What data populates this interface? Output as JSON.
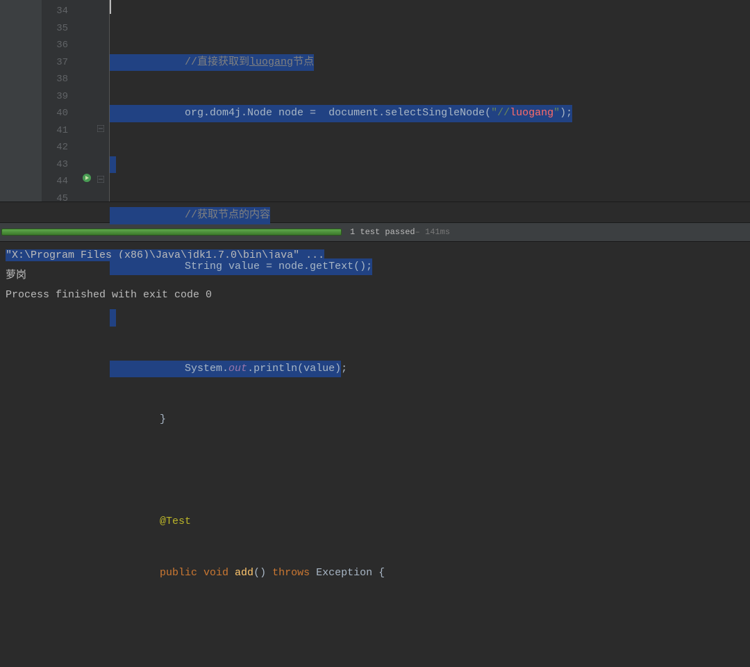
{
  "gutter": {
    "lines": [
      "34",
      "35",
      "36",
      "37",
      "38",
      "39",
      "40",
      "41",
      "42",
      "43",
      "44",
      "45"
    ]
  },
  "code": {
    "l34_pad": "            ",
    "l34_comment_a": "//直接获取到",
    "l34_comment_b": "luogang",
    "l34_comment_c": "节点",
    "l35_pad": "            ",
    "l35_a": "org.dom4j.Node node =  document.selectSingleNode(",
    "l35_str_open": "\"//",
    "l35_str_err": "luogang",
    "l35_str_close": "\"",
    "l35_b": ");",
    "l37_pad": "            ",
    "l37_comment": "//获取节点的内容",
    "l38_pad": "            ",
    "l38_a": "String value = node.getText();",
    "l40_pad": "            ",
    "l40_a": "System.",
    "l40_out": "out",
    "l40_b": ".println(value)",
    "l40_c": ";",
    "l41_pad": "        ",
    "l41_brace": "}",
    "l43_pad": "        ",
    "l43_anno": "@Test",
    "l44_pad": "        ",
    "l44_kw1": "public ",
    "l44_kw2": "void ",
    "l44_method": "add",
    "l44_a": "() ",
    "l44_kw3": "throws ",
    "l44_b": "Exception {"
  },
  "progress": {
    "text": "1 test passed",
    "time": " – 141ms"
  },
  "console": {
    "cmd": "\"X:\\Program Files (x86)\\Java\\jdk1.7.0\\bin\\java\" ...",
    "out1": "萝岗",
    "blank": "",
    "exit": "Process finished with exit code 0"
  }
}
